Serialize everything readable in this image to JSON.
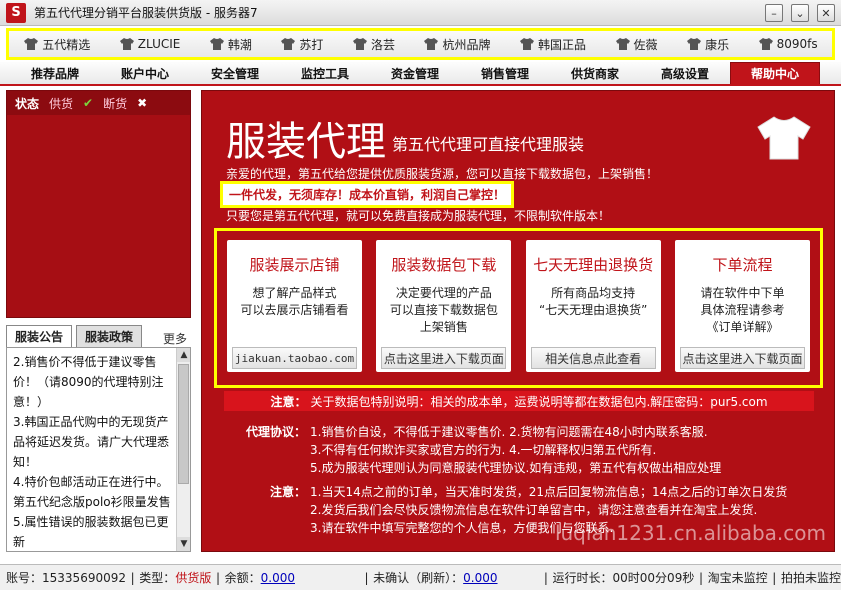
{
  "window": {
    "title": "第五代代理分销平台服装供货版 - 服务器7",
    "logo_letter": "S",
    "buttons": {
      "minimize": "–",
      "restore": "⌄",
      "close": "✕"
    }
  },
  "brands": [
    "五代精选",
    "ZLUCIE",
    "韩潮",
    "苏打",
    "洛芸",
    "杭州品牌",
    "韩国正品",
    "佐薇",
    "康乐",
    "8090fs"
  ],
  "menu": {
    "items": [
      "推荐品牌",
      "账户中心",
      "安全管理",
      "监控工具",
      "资金管理",
      "销售管理",
      "供货商家",
      "高级设置",
      "帮助中心"
    ],
    "active": "帮助中心"
  },
  "status_panel": {
    "title": "状态",
    "supply_label": "供货",
    "supply_icon": "✔",
    "out_label": "断货",
    "out_icon": "✖"
  },
  "notice_panel": {
    "tabs": [
      "服装公告",
      "服装政策"
    ],
    "more": "更多",
    "items": [
      "2.销售价不得低于建议零售价！（请8090的代理特别注意！）",
      "3.韩国正品代购中的无现货产品将延迟发货。请广大代理悉知！",
      "4.特价包邮活动正在进行中。第五代纪念版polo衫限量发售",
      "5.属性错误的服装数据包已更新"
    ]
  },
  "main": {
    "hero_title": "服装代理",
    "hero_subtitle": "第五代代理可直接代理服装",
    "intro1": "亲爱的代理，第五代给您提供优质服装货源，您可以直接下载数据包，上架销售！",
    "highlight": "一件代发，无须库存！成本价直销，利润自己掌控！",
    "intro2": "只要您是第五代代理，就可以免费直接成为服装代理，不限制软件版本！",
    "cards": [
      {
        "title": "服装展示店铺",
        "body": "想了解产品样式\n可以去展示店铺看看",
        "button": "jiakuan.taobao.com"
      },
      {
        "title": "服装数据包下载",
        "body": "决定要代理的产品\n可以直接下载数据包\n上架销售",
        "button": "点击这里进入下载页面"
      },
      {
        "title": "七天无理由退换货",
        "body": "所有商品均支持\n“七天无理由退换货”",
        "button": "相关信息点此查看"
      },
      {
        "title": "下单流程",
        "body": "请在软件中下单\n具体流程请参考\n《订单详解》",
        "button": "点击这里进入下载页面"
      }
    ],
    "notice_label": "注意：",
    "notice_text": "关于数据包特别说明：相关的成本单，运费说明等都在数据包内.解压密码：pur5.com",
    "agreement_label": "代理协议：",
    "agreement_lines": [
      "1.销售价自设，不得低于建议零售价. 2.货物有问题需在48小时内联系客服.",
      "3.不得有任何欺诈买家或官方的行为. 4.一切解释权归第五代所有.",
      "5.成为服装代理则认为同意服装代理协议.如有违规，第五代有权做出相应处理"
    ],
    "ship_label": "注意：",
    "ship_lines": [
      "1.当天14点之前的订单，当天准时发货，21点后回复物流信息；14点之后的订单次日发货",
      "2.发货后我们会尽快反馈物流信息在软件订单留言中，请您注意查看并在淘宝上发货.",
      "3.请在软件中填写完整您的个人信息，方便我们与您联系."
    ],
    "watermark": "luqian1231.cn.alibaba.com"
  },
  "statusbar": {
    "account_label": "账号：",
    "account": "15335690092",
    "type_label": "类型：",
    "type": "供货版",
    "balance_label": "余额：",
    "balance": "0.000",
    "unconfirmed_label": "未确认（刷新）：",
    "unconfirmed": "0.000",
    "runtime_label": "运行时长：",
    "runtime": "00时00分09秒",
    "taobao_monitor": "淘宝未监控",
    "paipai_monitor": "拍拍未监控"
  }
}
